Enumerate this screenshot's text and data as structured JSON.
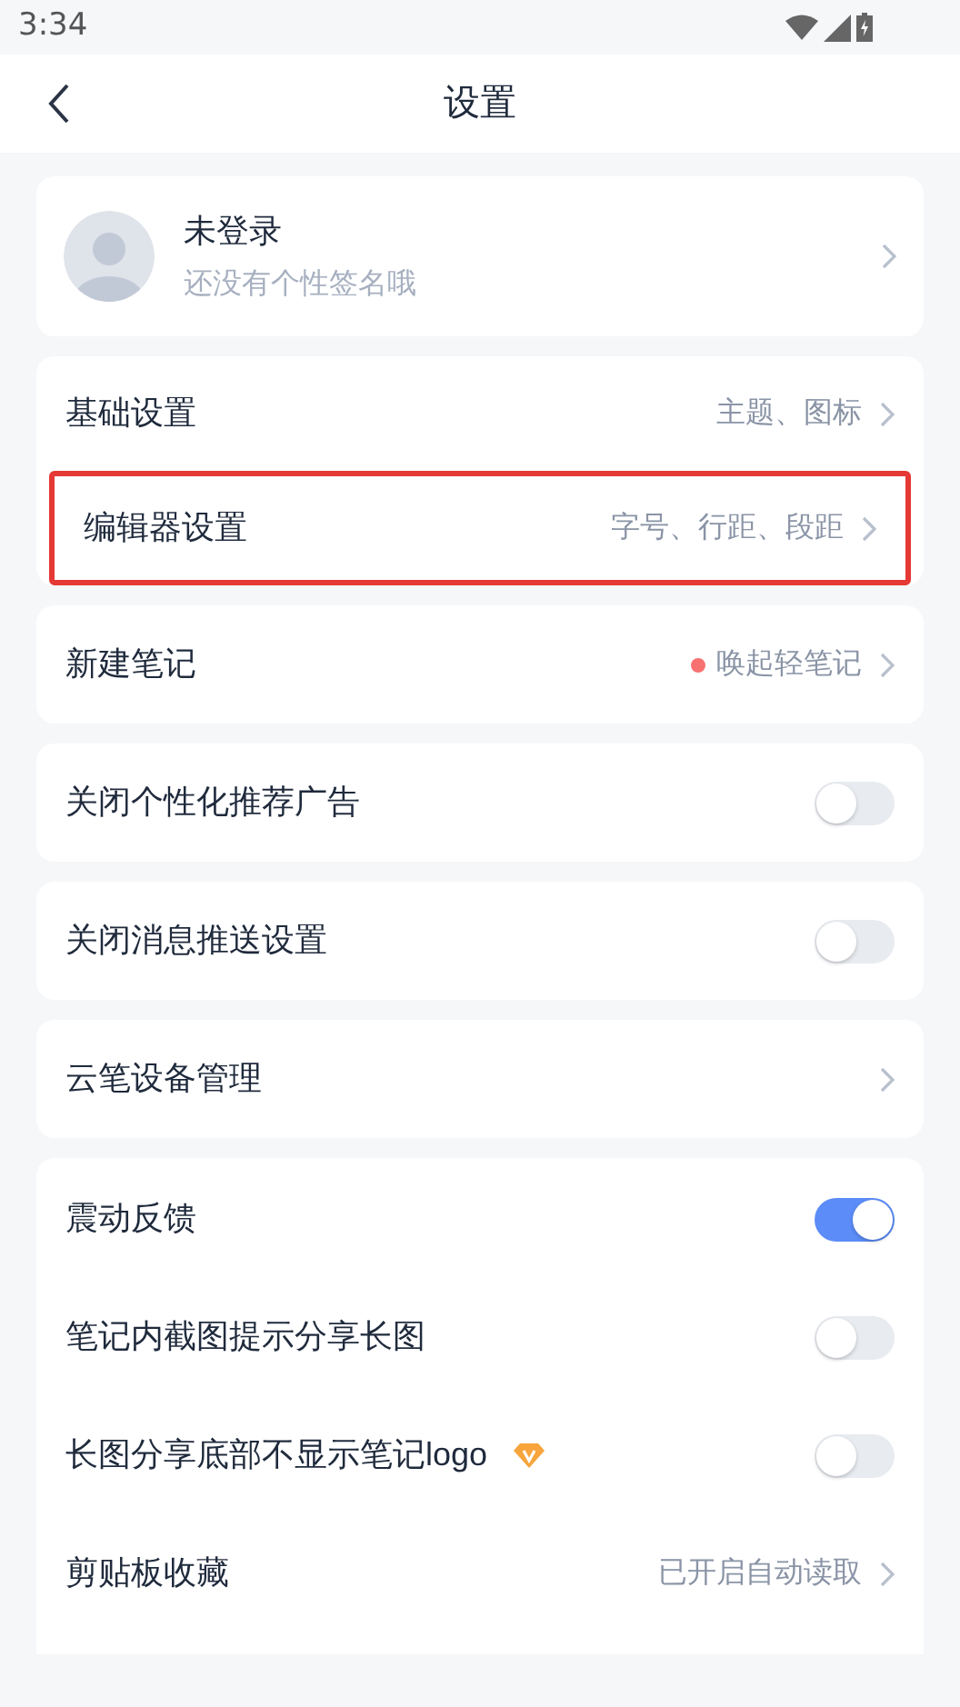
{
  "status_bar": {
    "time": "3:34"
  },
  "header": {
    "title": "设置"
  },
  "profile": {
    "name": "未登录",
    "signature": "还没有个性签名哦"
  },
  "groups": [
    {
      "rows": [
        {
          "kind": "link",
          "label": "基础设置",
          "value": "主题、图标",
          "highlighted": false
        },
        {
          "kind": "link",
          "label": "编辑器设置",
          "value": "字号、行距、段距",
          "highlighted": true
        }
      ]
    },
    {
      "rows": [
        {
          "kind": "link",
          "label": "新建笔记",
          "value": "唤起轻笔记",
          "color": "#f87171",
          "highlighted": false
        }
      ]
    },
    {
      "rows": [
        {
          "kind": "toggle",
          "label": "关闭个性化推荐广告",
          "on": false
        }
      ]
    },
    {
      "rows": [
        {
          "kind": "toggle",
          "label": "关闭消息推送设置",
          "on": false
        }
      ]
    },
    {
      "rows": [
        {
          "kind": "link",
          "label": "云笔设备管理",
          "highlighted": false
        }
      ]
    },
    {
      "rows": [
        {
          "kind": "toggle",
          "label": "震动反馈",
          "on": true
        },
        {
          "kind": "toggle",
          "label": "笔记内截图提示分享长图",
          "on": false
        },
        {
          "kind": "toggle",
          "label": "长图分享底部不显示笔记logo",
          "on": false,
          "vip": true
        },
        {
          "kind": "link",
          "label": "剪贴板收藏",
          "value": "已开启自动读取",
          "highlighted": false
        }
      ]
    }
  ]
}
